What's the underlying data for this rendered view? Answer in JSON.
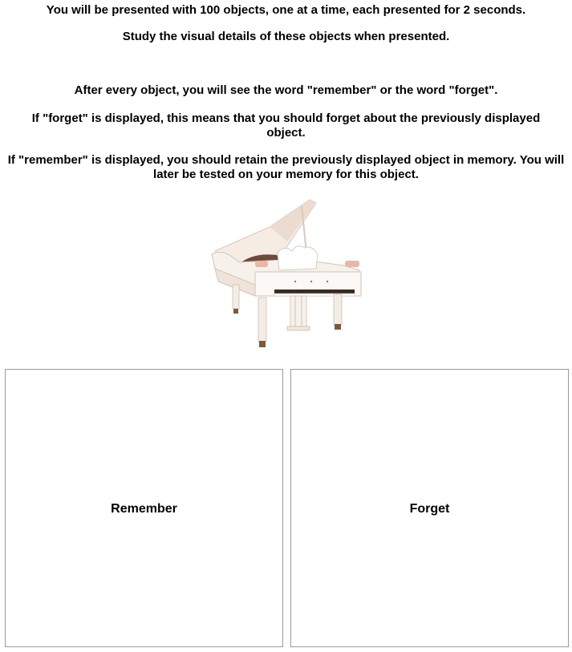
{
  "instructions": {
    "line1": "You will be presented with 100 objects, one at a time, each presented for 2 seconds.",
    "line2": "Study the visual details of these objects when presented.",
    "line3": "After every object, you will see the word \"remember\" or the word \"forget\".",
    "line4": "If \"forget\" is displayed, this means that you should forget about the previously displayed object.",
    "line5": "If \"remember\" is displayed, you should retain the previously displayed object in memory. You will later be tested on your memory for this object."
  },
  "stimulus": {
    "icon": "grand-piano",
    "color": "#f4ede6"
  },
  "choices": {
    "remember_label": "Remember",
    "forget_label": "Forget"
  }
}
